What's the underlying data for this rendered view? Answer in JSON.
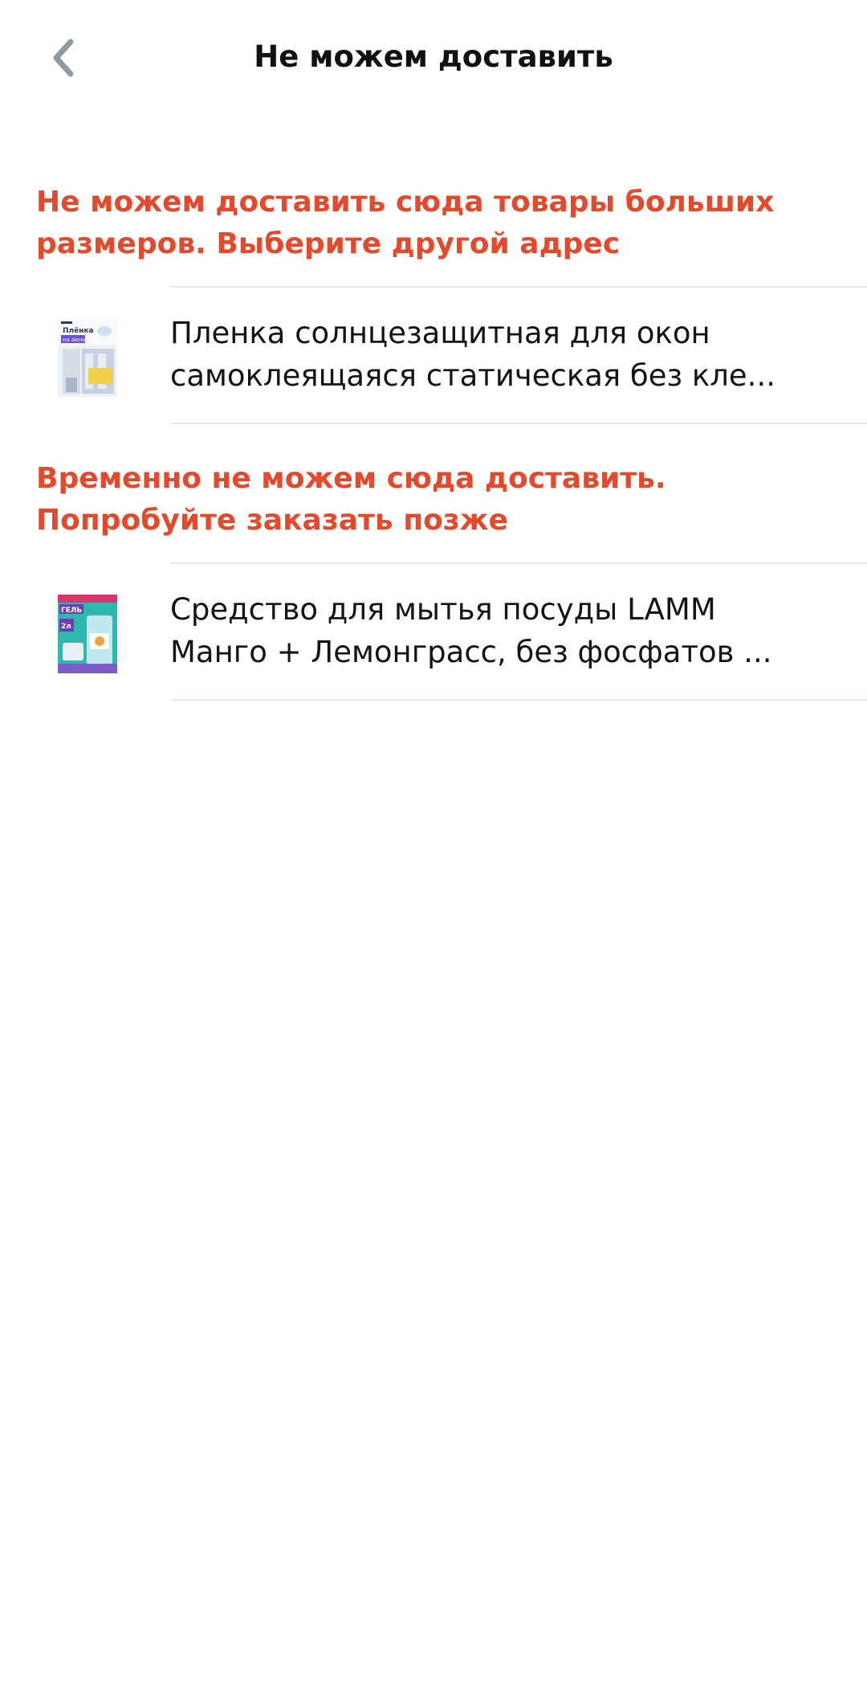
{
  "header": {
    "title": "Не можем доставить",
    "back_icon": "chevron-left-icon"
  },
  "colors": {
    "accent": "#E5492B",
    "divider": "#E6E6E6",
    "back_icon": "#8E99A6"
  },
  "sections": [
    {
      "title_line1": "Не можем доставить сюда товары больших",
      "title_line2": "размеров. Выберите другой адрес",
      "product": {
        "line1": "Пленка солнцезащитная для окон",
        "line2": "самоклеящаяся статическая без кле...",
        "thumb_text_top": "Плёнка",
        "thumb_text_bottom": "на окно"
      }
    },
    {
      "title_line1": "Временно не можем сюда доставить.",
      "title_line2": "Попробуйте заказать позже",
      "product": {
        "line1": "Средство для мытья посуды LAMM",
        "line2": "Манго + Лемонграсс, без фосфатов ...",
        "thumb_text_top": "ГЕЛЬ",
        "thumb_text_bottom": "2л"
      }
    }
  ]
}
